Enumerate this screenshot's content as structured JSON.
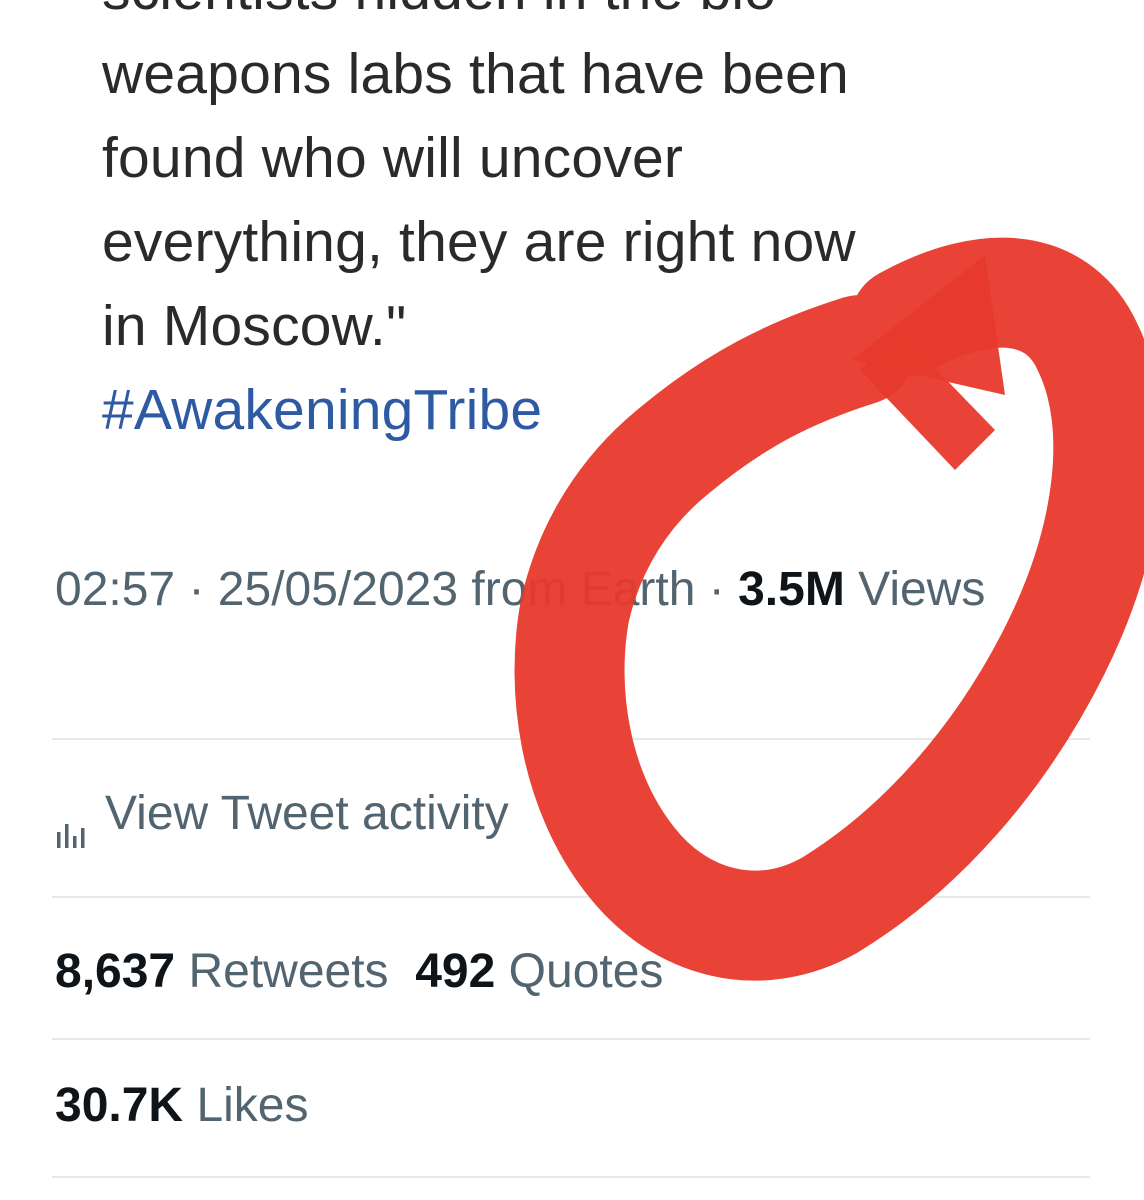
{
  "tweet": {
    "text_lines": [
      "scientists hidden in the bio-",
      "weapons labs that have been",
      "found who will uncover",
      "everything, they are right now",
      "in Moscow.\""
    ],
    "hashtag": "#AwakeningTribe"
  },
  "meta": {
    "time": "02:57",
    "date": "25/05/2023",
    "source": "from Earth",
    "separator": "·",
    "views_count": "3.5M",
    "views_label": "Views"
  },
  "activity": {
    "icon": "bar-chart-icon",
    "label": "View Tweet activity"
  },
  "stats": {
    "retweets_count": "8,637",
    "retweets_label": "Retweets",
    "quotes_count": "492",
    "quotes_label": "Quotes",
    "likes_count": "30.7K",
    "likes_label": "Likes"
  },
  "colors": {
    "text_secondary": "#536471",
    "text_primary": "#0f1419",
    "hashtag": "#2e5aa3",
    "annotation_red": "#e8392d"
  }
}
